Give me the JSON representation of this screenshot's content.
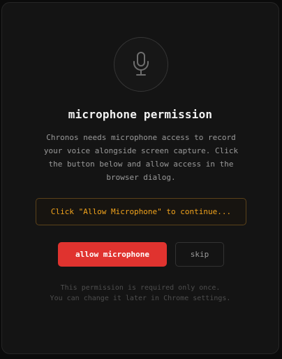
{
  "dialog": {
    "icon": "microphone-icon",
    "title": "microphone permission",
    "description": "Chronos needs microphone access to record your voice alongside screen capture. Click the button below and allow access in the browser dialog.",
    "notice": "Click \"Allow Microphone\" to continue...",
    "allow_label": "allow microphone",
    "skip_label": "skip",
    "footnote_line1": "This permission is required only once.",
    "footnote_line2": "You can change it later in Chrome settings."
  },
  "colors": {
    "background": "#141414",
    "accent": "#e0332f",
    "notice_text": "#f1a31c",
    "notice_border": "#5b421a",
    "title": "#f2f2f2",
    "muted_text": "#9a9a9a"
  }
}
